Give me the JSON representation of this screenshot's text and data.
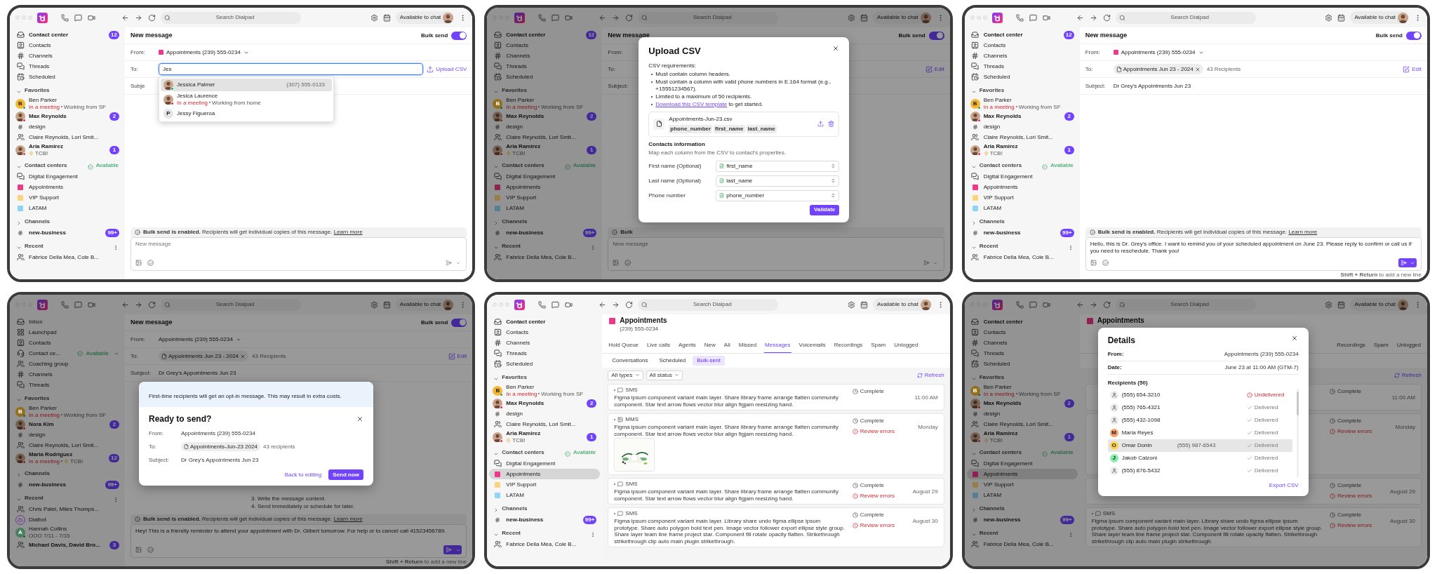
{
  "screens": [
    {
      "topbar": {
        "search": {
          "placeholder": "Search Dialpad"
        },
        "status": "Available to chat"
      },
      "sidebar": [
        {
          "kind": "inbox",
          "label": "Contact center",
          "unread": true,
          "selected": false,
          "badge": "12"
        },
        {
          "kind": "contacts",
          "label": "Contacts",
          "unread": false,
          "selected": false
        },
        {
          "kind": "hash",
          "label": "Channels",
          "unread": false,
          "selected": false
        },
        {
          "kind": "threads",
          "label": "Threads",
          "unread": false,
          "selected": false
        },
        {
          "kind": "scheduled",
          "label": "Scheduled",
          "unread": false,
          "selected": false
        },
        {
          "kind": "section",
          "label": "Favorites",
          "expanded": true
        },
        {
          "kind": "person",
          "avatar": {
            "kind": "initial",
            "initial": "B",
            "color": "#f5b731"
          },
          "online": true,
          "label": "Ben Parker",
          "meeting": "In a meeting",
          "note": "Working from SF",
          "unread": false,
          "selected": false
        },
        {
          "kind": "person",
          "online": false,
          "label": "Max Reynolds",
          "unread": true,
          "selected": false,
          "badge": "2"
        },
        {
          "kind": "channel",
          "label": "design",
          "unread": false,
          "selected": false
        },
        {
          "kind": "people",
          "label": "Claire Reynolds, Lori Smit...",
          "unread": false,
          "selected": false
        },
        {
          "kind": "person",
          "online": false,
          "label": "Aria Ramirez",
          "note": "TCB!",
          "flash": true,
          "unread": true,
          "selected": false,
          "badge": "1"
        },
        {
          "kind": "section",
          "label": "Contact centers",
          "expanded": true,
          "status": "Available"
        },
        {
          "kind": "chat",
          "label": "Digital Engagement",
          "unread": false,
          "selected": false
        },
        {
          "kind": "color",
          "color": "#f0388a",
          "label": "Appointments",
          "unread": false,
          "selected": false
        },
        {
          "kind": "color",
          "color": "#fcd27a",
          "label": "VIP Support",
          "unread": false,
          "selected": false
        },
        {
          "kind": "color",
          "color": "#8ed4f5",
          "label": "LATAM",
          "unread": false,
          "selected": false
        },
        {
          "kind": "section",
          "label": "Channels",
          "expanded": false
        },
        {
          "kind": "channel",
          "label": "new-business",
          "unread": true,
          "selected": false,
          "badge": "99+"
        },
        {
          "kind": "section",
          "label": "Recent",
          "expanded": true,
          "menu": true
        },
        {
          "kind": "people",
          "label": "Fabrice Della Mea, Cole B...",
          "unread": false,
          "selected": false
        }
      ],
      "main": {
        "kind": "compose",
        "title": "New message",
        "bulk_send": {
          "label": "Bulk send",
          "on": true
        },
        "fields": [
          {
            "kind": "from",
            "label": "From:",
            "value": "Appointments (239) 555-0234",
            "swatch": true
          },
          {
            "kind": "to",
            "label": "To:",
            "value": "Jes",
            "focused": true,
            "action": {
              "kind": "upload",
              "label": "Upload CSV"
            }
          },
          {
            "kind": "subject",
            "label": "Subje"
          }
        ],
        "notice": {
          "bold": "Bulk send is enabled.",
          "text": "Recipients will get individual copies of this message.",
          "link": "Learn more"
        },
        "composer": {
          "placeholder": "New message",
          "send_active": false
        }
      },
      "overlay": {
        "kind": "suggestions",
        "items": [
          {
            "online": true,
            "name": "Jessica Palmer",
            "phone": "(307) 555-0133",
            "selected": true
          },
          {
            "online": false,
            "name": "Jesica Laurence",
            "meeting": "In a meeting",
            "note": "Working from home",
            "selected": false
          },
          {
            "avatar": {
              "kind": "initial",
              "initial": "P"
            },
            "name": "Jessy Figueroa",
            "selected": false
          }
        ]
      }
    },
    {
      "topbar": {
        "search": {
          "placeholder": "Search Dialpad"
        },
        "status": "Available to chat"
      },
      "sidebar": [
        {
          "kind": "inbox",
          "label": "Contact center",
          "unread": true,
          "selected": false,
          "badge": "12"
        },
        {
          "kind": "contacts",
          "label": "Contacts",
          "unread": false,
          "selected": false
        },
        {
          "kind": "hash",
          "label": "Channels",
          "unread": false,
          "selected": false
        },
        {
          "kind": "threads",
          "label": "Threads",
          "unread": false,
          "selected": false
        },
        {
          "kind": "scheduled",
          "label": "Scheduled",
          "unread": false,
          "selected": false
        },
        {
          "kind": "section",
          "label": "Favorites",
          "expanded": true
        },
        {
          "kind": "person",
          "avatar": {
            "kind": "initial",
            "initial": "B",
            "color": "#936e1d"
          },
          "online": true,
          "label": "Ben Parker",
          "meeting": "In a meeting",
          "note": "Working from SF",
          "unread": false,
          "selected": false
        },
        {
          "kind": "person",
          "online": false,
          "label": "Max Reynolds",
          "unread": true,
          "selected": false,
          "badge": "2"
        },
        {
          "kind": "channel",
          "label": "design",
          "unread": false,
          "selected": false
        },
        {
          "kind": "people",
          "label": "Claire Reynolds, Lori Smit...",
          "unread": false,
          "selected": false
        },
        {
          "kind": "person",
          "online": false,
          "label": "Aria Ramirez",
          "note": "TCB!",
          "flash": true,
          "unread": true,
          "selected": false,
          "badge": "1"
        },
        {
          "kind": "section",
          "label": "Contact centers",
          "expanded": true,
          "status": "Available"
        },
        {
          "kind": "chat",
          "label": "Digital Engagement",
          "unread": false,
          "selected": false
        },
        {
          "kind": "color",
          "color": "#902253",
          "label": "Appointments",
          "unread": false,
          "selected": false
        },
        {
          "kind": "color",
          "color": "#977e49",
          "label": "VIP Support",
          "unread": false,
          "selected": false
        },
        {
          "kind": "color",
          "color": "#557f93",
          "label": "LATAM",
          "unread": false,
          "selected": false
        },
        {
          "kind": "section",
          "label": "Channels",
          "expanded": false
        },
        {
          "kind": "channel",
          "label": "new-business",
          "unread": true,
          "selected": false,
          "badge": "99+"
        },
        {
          "kind": "section",
          "label": "Recent",
          "expanded": true,
          "menu": true
        },
        {
          "kind": "people",
          "label": "Fabrice Della Mea, Cole B...",
          "unread": false,
          "selected": false
        }
      ],
      "main": {
        "kind": "compose",
        "title": "New message",
        "bulk_send": {
          "label": "Bulk send",
          "on": true
        },
        "fields": [
          {
            "kind": "from",
            "label": "From:"
          },
          {
            "kind": "to",
            "label": "To:",
            "action": {
              "kind": "edit",
              "label": "Edit"
            }
          },
          {
            "kind": "subject",
            "label": "Subject:"
          }
        ],
        "notice": {
          "bold": "Bulk"
        },
        "composer": {
          "placeholder": "New message",
          "send_active": false
        }
      },
      "overlay": {
        "kind": "upload_csv",
        "title": "Upload CSV",
        "requirements_label": "CSV requirements:",
        "requirements": [
          {
            "text": "Must contain column headers."
          },
          {
            "text": "Must contain a column with valid phone numbers in E.164 format (e.g., +15551234567)."
          },
          {
            "text": "Limited to a maximum of 50 recipients."
          },
          {
            "link": "Download this CSV template",
            "text": "to get started."
          }
        ],
        "file": {
          "name": "Appointments-Jun-23.csv",
          "columns": [
            "phone_number",
            "first_name",
            "last_name"
          ]
        },
        "contacts_title": "Contacts information",
        "contacts_hint": "Map each column from the CSV to contact's properties.",
        "mappings": [
          {
            "label": "First name (Optional)",
            "value": "first_name"
          },
          {
            "label": "Last name (Optional)",
            "value": "last_name"
          },
          {
            "label": "Phone number",
            "value": "phone_number"
          }
        ],
        "primary": "Validate"
      }
    },
    {
      "topbar": {
        "search": {
          "placeholder": "Search Dialpad"
        },
        "status": "Available to chat"
      },
      "sidebar": [
        {
          "kind": "inbox",
          "label": "Contact center",
          "unread": true,
          "selected": false,
          "badge": "12"
        },
        {
          "kind": "contacts",
          "label": "Contacts",
          "unread": false,
          "selected": false
        },
        {
          "kind": "hash",
          "label": "Channels",
          "unread": false,
          "selected": false
        },
        {
          "kind": "threads",
          "label": "Threads",
          "unread": false,
          "selected": false
        },
        {
          "kind": "scheduled",
          "label": "Scheduled",
          "unread": false,
          "selected": false
        },
        {
          "kind": "section",
          "label": "Favorites",
          "expanded": true
        },
        {
          "kind": "person",
          "avatar": {
            "kind": "initial",
            "initial": "B",
            "color": "#f5b731"
          },
          "online": true,
          "label": "Ben Parker",
          "meeting": "In a meeting",
          "note": "Working from SF",
          "unread": false,
          "selected": false
        },
        {
          "kind": "person",
          "online": false,
          "label": "Max Reynolds",
          "unread": true,
          "selected": false,
          "badge": "2"
        },
        {
          "kind": "channel",
          "label": "design",
          "unread": false,
          "selected": false
        },
        {
          "kind": "people",
          "label": "Claire Reynolds, Lori Smit...",
          "unread": false,
          "selected": false
        },
        {
          "kind": "person",
          "online": false,
          "label": "Aria Ramirez",
          "note": "TCB!",
          "flash": true,
          "unread": true,
          "selected": false,
          "badge": "1"
        },
        {
          "kind": "section",
          "label": "Contact centers",
          "expanded": true,
          "status": "Available"
        },
        {
          "kind": "chat",
          "label": "Digital Engagement",
          "unread": false,
          "selected": false
        },
        {
          "kind": "color",
          "color": "#f0388a",
          "label": "Appointments",
          "unread": false,
          "selected": false
        },
        {
          "kind": "color",
          "color": "#fcd27a",
          "label": "VIP Support",
          "unread": false,
          "selected": false
        },
        {
          "kind": "color",
          "color": "#8ed4f5",
          "label": "LATAM",
          "unread": false,
          "selected": false
        },
        {
          "kind": "section",
          "label": "Channels",
          "expanded": false
        },
        {
          "kind": "channel",
          "label": "new-business",
          "unread": true,
          "selected": false,
          "badge": "99+"
        },
        {
          "kind": "section",
          "label": "Recent",
          "expanded": true,
          "menu": true
        },
        {
          "kind": "people",
          "label": "Fabrice Della Mea, Cole B...",
          "unread": false,
          "selected": false
        }
      ],
      "main": {
        "kind": "compose",
        "title": "New message",
        "bulk_send": {
          "label": "Bulk send",
          "on": true
        },
        "fields": [
          {
            "kind": "from",
            "label": "From:",
            "value": "Appointments (239) 555-0234",
            "swatch": true
          },
          {
            "kind": "to",
            "label": "To:",
            "chip": "Appointments Jun 23 - 2024",
            "count": "43 Recipients",
            "action": {
              "kind": "edit",
              "label": "Edit"
            }
          },
          {
            "kind": "subject",
            "label": "Subject:",
            "value": "Dr Grey's Appointments Jun 23"
          }
        ],
        "notice": {
          "bold": "Bulk send is enabled.",
          "text": "Recipients will get individual copies of this message.",
          "link": "Learn more"
        },
        "composer": {
          "value": "Hello, this is Dr. Grey's office. I want to remind you of your scheduled appointment on June 23. Please reply to confirm or call us if you need to reschedule. Thank you!",
          "send_active": true
        },
        "hint": "**Shift + Return** to add a new line"
      }
    },
    {
      "topbar": {
        "search": {
          "placeholder": "Search Dialpad"
        },
        "status": "Available to chat"
      },
      "sidebar": [
        {
          "kind": "inbox",
          "label": "Inbox",
          "unread": false,
          "selected": false
        },
        {
          "kind": "grid",
          "label": "Launchpad",
          "unread": false,
          "selected": false
        },
        {
          "kind": "contacts",
          "label": "Contacts",
          "unread": false,
          "selected": false
        },
        {
          "kind": "headset",
          "label": "Contact ce...",
          "status": "Available",
          "unread": false,
          "selected": false
        },
        {
          "kind": "people",
          "label": "Coaching group",
          "unread": false,
          "selected": false
        },
        {
          "kind": "hash",
          "label": "Channels",
          "unread": false,
          "selected": false
        },
        {
          "kind": "threads",
          "label": "Threads",
          "unread": false,
          "selected": false
        },
        {
          "kind": "section",
          "label": "Favorites",
          "expanded": true
        },
        {
          "kind": "person",
          "avatar": {
            "kind": "initial",
            "initial": "B",
            "color": "#936e1d"
          },
          "online": true,
          "label": "Ben Parker",
          "meeting": "In a meeting",
          "note": "Working from SF",
          "unread": false,
          "selected": false
        },
        {
          "kind": "person",
          "online": false,
          "label": "Nora Kim",
          "unread": true,
          "selected": false,
          "badge": "2"
        },
        {
          "kind": "channel",
          "label": "design",
          "unread": false,
          "selected": false
        },
        {
          "kind": "people",
          "label": "Claire Reynolds, Lori Smit...",
          "unread": false,
          "selected": false
        },
        {
          "kind": "person",
          "online": false,
          "label": "Maria Rodriguez",
          "meeting": "In a meeting",
          "note": "TCB!",
          "flash": true,
          "unread": true,
          "selected": false,
          "badge": "12"
        },
        {
          "kind": "section",
          "label": "Channels",
          "expanded": false
        },
        {
          "kind": "channel",
          "label": "new-business",
          "unread": true,
          "selected": false,
          "badge": "99+"
        },
        {
          "kind": "section",
          "label": "Recent",
          "expanded": true,
          "menu": true
        },
        {
          "kind": "people",
          "label": "Chris Patel, Miles Thomps...",
          "unread": false,
          "selected": false
        },
        {
          "kind": "person",
          "avatar": {
            "kind": "bot"
          },
          "label": "Dialbot",
          "unread": false,
          "selected": false
        },
        {
          "kind": "person",
          "avatar": {
            "kind": "initial",
            "initial": "A",
            "color": "#4b7f60"
          },
          "online": true,
          "label": "Hannah Collins",
          "note": "OOO 7/11 - 7/15",
          "unread": false,
          "selected": false
        },
        {
          "kind": "people",
          "label": "Michael Davis, David Bro...",
          "unread": true,
          "selected": false,
          "badge": "3"
        }
      ],
      "main": {
        "kind": "compose",
        "title": "New message",
        "bulk_send": {
          "label": "Bulk send",
          "on": true
        },
        "fields": [
          {
            "kind": "from",
            "label": "From:",
            "value": "Appointments (239) 555-0234",
            "swatch": false
          },
          {
            "kind": "to",
            "label": "To:",
            "chip": "Appointments Jun 23 - 2024",
            "count": "43 Recipients",
            "action": {
              "kind": "edit",
              "label": "Edit"
            }
          },
          {
            "kind": "subject",
            "label": "Subject:",
            "value": "Dr Grey's Appointments Jun 23"
          }
        ],
        "body_lines": [
          "3. Write the message content.",
          "4. Send immediately or schedule for later."
        ],
        "notice": {
          "bold": "Bulk send is enabled.",
          "text": "Recipients will get individual copies of this message.",
          "link": "Learn more"
        },
        "composer": {
          "value": "Hey! This is a friendly reminder to attend your appointment with Dr. Gilbert tomorrow. For help or to cancel call 41523456789.",
          "send_active": true
        },
        "hint": "**Shift + Return** to add a new line"
      },
      "overlay": {
        "kind": "confirm",
        "banner": "First-time recipients will get an opt-in message. This may result in extra costs.",
        "title": "Ready to send?",
        "rows": [
          {
            "label": "From:",
            "value": "Appointments (239) 555-0234"
          },
          {
            "label": "To:",
            "chip": "Appointments-Jun-23 2024",
            "count": "43 recipients"
          },
          {
            "label": "Subject:",
            "value": "Dr Grey's Appointments Jun 23"
          }
        ],
        "secondary": "Back to editing",
        "primary": "Send now"
      }
    },
    {
      "topbar": {
        "search": {
          "placeholder": "Search Dialpad"
        },
        "status": "Available to chat"
      },
      "sidebar": [
        {
          "kind": "inbox",
          "label": "Contact center",
          "unread": true,
          "selected": false
        },
        {
          "kind": "contacts",
          "label": "Contacts",
          "unread": false,
          "selected": false
        },
        {
          "kind": "hash",
          "label": "Channels",
          "unread": false,
          "selected": false
        },
        {
          "kind": "threads",
          "label": "Threads",
          "unread": false,
          "selected": false
        },
        {
          "kind": "scheduled",
          "label": "Scheduled",
          "unread": false,
          "selected": false
        },
        {
          "kind": "section",
          "label": "Favorites",
          "expanded": true
        },
        {
          "kind": "person",
          "avatar": {
            "kind": "initial",
            "initial": "B",
            "color": "#f5b731"
          },
          "online": true,
          "label": "Ben Parker",
          "meeting": "In a meeting",
          "note": "Working from SF",
          "unread": false,
          "selected": false
        },
        {
          "kind": "person",
          "online": false,
          "label": "Max Reynolds",
          "unread": true,
          "selected": false,
          "badge": "2"
        },
        {
          "kind": "channel",
          "label": "design",
          "unread": false,
          "selected": false
        },
        {
          "kind": "people",
          "label": "Claire Reynolds, Lori Smit...",
          "unread": false,
          "selected": false
        },
        {
          "kind": "person",
          "online": false,
          "label": "Aria Ramirez",
          "note": "TCB!",
          "flash": true,
          "unread": true,
          "selected": false,
          "badge": "1"
        },
        {
          "kind": "section",
          "label": "Contact centers",
          "expanded": true,
          "status": "Available"
        },
        {
          "kind": "chat",
          "label": "Digital Engagement",
          "unread": false,
          "selected": false
        },
        {
          "kind": "color",
          "color": "#f0388a",
          "label": "Appointments",
          "unread": false,
          "selected": true
        },
        {
          "kind": "color",
          "color": "#fcd27a",
          "label": "VIP Support",
          "unread": false,
          "selected": false
        },
        {
          "kind": "color",
          "color": "#8ed4f5",
          "label": "LATAM",
          "unread": false,
          "selected": false
        },
        {
          "kind": "section",
          "label": "Channels",
          "expanded": false
        },
        {
          "kind": "channel",
          "label": "new-business",
          "unread": true,
          "selected": false,
          "badge": "99+"
        },
        {
          "kind": "section",
          "label": "Recent",
          "expanded": true,
          "menu": true
        },
        {
          "kind": "people",
          "label": "Fabrice Della Mea, Cole B...",
          "unread": false,
          "selected": false
        }
      ],
      "main": {
        "kind": "inbox",
        "header": {
          "title": "Appointments",
          "phone": "(239) 555-0234"
        },
        "tabs": [
          {
            "label": "Hold Queue",
            "selected": false
          },
          {
            "label": "Live calls",
            "selected": false
          },
          {
            "label": "Agents",
            "selected": false
          },
          {
            "label": "New",
            "selected": false
          },
          {
            "label": "All",
            "selected": false
          },
          {
            "label": "Missed",
            "selected": false
          },
          {
            "label": "Messages",
            "selected": true
          },
          {
            "label": "Voicemails",
            "selected": false
          },
          {
            "label": "Recordings",
            "selected": false
          },
          {
            "label": "Spam",
            "selected": false
          },
          {
            "label": "Unlogged",
            "selected": false
          }
        ],
        "subtabs": [
          {
            "label": "Conversations",
            "selected": false
          },
          {
            "label": "Scheduled",
            "selected": false
          },
          {
            "label": "Bulk-sent",
            "selected": true
          }
        ],
        "filters": [
          "All types",
          "All status"
        ],
        "refresh": "Refresh",
        "messages": [
          {
            "kind": "sms",
            "type": "SMS",
            "text": "Figma ipsum component variant main layer. Share library frame arrange flatten community component. Star text arrow flows vector blur align figjam reesizing hand.",
            "status": "Complete",
            "time": "11:00 AM"
          },
          {
            "kind": "mms",
            "type": "MMS",
            "text": "Figma ipsum component variant main layer. Share library frame arrange flatten community component. Star text arrow flows vector blur align figjam reesizing hand.",
            "status": "Complete",
            "error": "Review errors",
            "time": "Monday"
          },
          {
            "kind": "sms",
            "type": "SMS",
            "text": "Figma ipsum component variant main layer. Share library frame arrange flatten community component. Star text arrow flows vector blur align figjam reesizing hand.",
            "status": "Complete",
            "error": "Review errors",
            "time": "August 29"
          },
          {
            "kind": "sms",
            "type": "SMS",
            "text": "Figma ipsum component variant main layer. Library share undo figma ellipse ipsum prototype. Share auto polygon bold text pen. Image vector follower export ellipse style group. Share layer team line frame project star. Component fill rotate opacity flatten. Strikethrough strikethrough clip auto main plugin strikethrough.",
            "status": "Complete",
            "error": "Review errors",
            "time": "August 30"
          }
        ]
      }
    },
    {
      "topbar": {
        "search": {
          "placeholder": "Search Dialpad"
        },
        "status": "Available to chat"
      },
      "sidebar": [
        {
          "kind": "inbox",
          "label": "Contact center",
          "unread": true,
          "selected": false
        },
        {
          "kind": "contacts",
          "label": "Contacts",
          "unread": false,
          "selected": false
        },
        {
          "kind": "hash",
          "label": "Channels",
          "unread": false,
          "selected": false
        },
        {
          "kind": "threads",
          "label": "Threads",
          "unread": false,
          "selected": false
        },
        {
          "kind": "scheduled",
          "label": "Scheduled",
          "unread": false,
          "selected": false
        },
        {
          "kind": "section",
          "label": "Favorites",
          "expanded": true
        },
        {
          "kind": "person",
          "avatar": {
            "kind": "initial",
            "initial": "B",
            "color": "#936e1d"
          },
          "online": true,
          "label": "Ben Parker",
          "meeting": "In a meeting",
          "note": "Working from SF",
          "unread": false,
          "selected": false
        },
        {
          "kind": "person",
          "online": false,
          "label": "Max Reynolds",
          "unread": true,
          "selected": false,
          "badge": "2"
        },
        {
          "kind": "channel",
          "label": "design",
          "unread": false,
          "selected": false
        },
        {
          "kind": "people",
          "label": "Claire Reynolds, Lori Smit...",
          "unread": false,
          "selected": false
        },
        {
          "kind": "person",
          "online": false,
          "label": "Aria Ramirez",
          "note": "TCB!",
          "flash": true,
          "unread": true,
          "selected": false,
          "badge": "1"
        },
        {
          "kind": "section",
          "label": "Contact centers",
          "expanded": true,
          "status": "Available"
        },
        {
          "kind": "chat",
          "label": "Digital Engagement",
          "unread": false,
          "selected": false
        },
        {
          "kind": "color",
          "color": "#902253",
          "label": "Appointments",
          "unread": false,
          "selected": true
        },
        {
          "kind": "color",
          "color": "#977e49",
          "label": "VIP Support",
          "unread": false,
          "selected": false
        },
        {
          "kind": "color",
          "color": "#557f93",
          "label": "LATAM",
          "unread": false,
          "selected": false
        },
        {
          "kind": "section",
          "label": "Channels",
          "expanded": false
        },
        {
          "kind": "channel",
          "label": "new-business",
          "unread": true,
          "selected": false,
          "badge": "99+"
        },
        {
          "kind": "section",
          "label": "Recent",
          "expanded": true,
          "menu": true
        },
        {
          "kind": "people",
          "label": "Fabrice Della Mea, Cole B...",
          "unread": false,
          "selected": false
        }
      ],
      "main": {
        "kind": "inbox",
        "header": {
          "title": "Appointments"
        },
        "tabs": [
          {
            "label": "Recordings",
            "selected": false
          },
          {
            "label": "Spam",
            "selected": false
          },
          {
            "label": "Unlogged",
            "selected": false
          }
        ],
        "refresh": "Refresh",
        "messages": [
          {
            "kind": "sms",
            "status": "Complete",
            "time": "11:00 AM"
          },
          {
            "kind": "mms",
            "status": "Complete",
            "error": "Review errors",
            "time": "Monday"
          },
          {
            "kind": "sms",
            "status": "Complete",
            "error": "Review errors",
            "time": "August 29"
          },
          {
            "kind": "sms",
            "type": "SMS",
            "text": "Figma ipsum component variant main layer. Library share undo figma ellipse ipsum prototype. Share auto polygon bold text pen. Image vector follower export ellipse style group. Share layer team line frame project star. Component fill rotate opacity flatten. Strikethrough strikethrough clip auto main plugin strikethrough.",
            "status": "Complete",
            "error": "Review errors",
            "time": "August 30"
          }
        ]
      },
      "overlay": {
        "kind": "details",
        "title": "Details",
        "rows": [
          {
            "label": "From:",
            "value": "Appointments (239) 555-0234"
          },
          {
            "label": "Date:",
            "value": "June 23 at 11:00 AM (GTM-7)"
          }
        ],
        "recipients_label": "Recipients (50)",
        "recipients": [
          {
            "avatar": {
              "kind": "contact"
            },
            "name": "(555) 654-3210",
            "kind": "failed",
            "status": "Undelivered",
            "selected": false
          },
          {
            "avatar": {
              "kind": "contact"
            },
            "name": "(555) 765-4321",
            "kind": "delivered",
            "status": "Delivered",
            "selected": false
          },
          {
            "avatar": {
              "kind": "contact"
            },
            "name": "(555) 432-1098",
            "kind": "delivered",
            "status": "Delivered",
            "selected": false
          },
          {
            "avatar": {
              "kind": "initial",
              "initial": "M",
              "color": "#f7a26b"
            },
            "name": "Maria Reyes",
            "kind": "delivered",
            "status": "Delivered",
            "selected": false
          },
          {
            "avatar": {
              "kind": "initial",
              "initial": "O",
              "color": "#fcd34d"
            },
            "name": "Omar Donin",
            "phone": "(555) 987-6543",
            "kind": "delivered",
            "status": "Delivered",
            "selected": true
          },
          {
            "avatar": {
              "kind": "initial",
              "initial": "J",
              "color": "#86efac"
            },
            "name": "Jakob Calzoni",
            "kind": "delivered",
            "status": "Delivered",
            "selected": false
          },
          {
            "avatar": {
              "kind": "contact"
            },
            "name": "(555) 876-5432",
            "kind": "delivered",
            "status": "Delivered",
            "selected": false
          }
        ],
        "export": "Export CSV"
      }
    }
  ]
}
